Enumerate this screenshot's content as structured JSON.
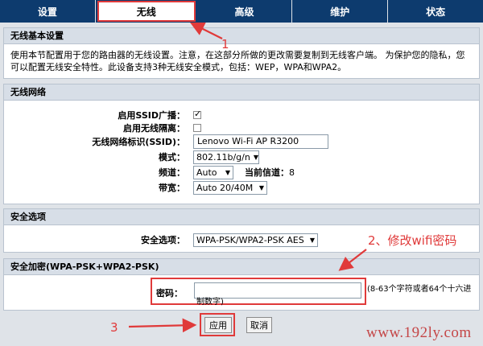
{
  "nav": {
    "tabs": [
      {
        "label": "设置"
      },
      {
        "label": "无线"
      },
      {
        "label": "高级"
      },
      {
        "label": "维护"
      },
      {
        "label": "状态"
      }
    ],
    "active_index": 1
  },
  "basic": {
    "title": "无线基本设置",
    "description": "使用本节配置用于您的路由器的无线设置。注意，在这部分所做的更改需要复制到无线客户端。 为保护您的隐私，您可以配置无线安全特性。此设备支持3种无线安全模式，包括：WEP，WPA和WPA2。"
  },
  "network": {
    "title": "无线网络",
    "ssid_broadcast_label": "启用SSID广播：",
    "ssid_broadcast_checked": true,
    "isolation_label": "启用无线隔离：",
    "isolation_checked": false,
    "ssid_label": "无线网络标识(SSID)：",
    "ssid_value": "Lenovo Wi-Fi AP R3200",
    "mode_label": "模式：",
    "mode_value": "802.11b/g/n",
    "channel_label": "频道：",
    "channel_value": "Auto",
    "current_channel_label": "当前信道：",
    "current_channel_value": "8",
    "bandwidth_label": "带宽：",
    "bandwidth_value": "Auto 20/40M"
  },
  "security": {
    "title": "安全选项",
    "option_label": "安全选项：",
    "option_value": "WPA-PSK/WPA2-PSK AES"
  },
  "encryption": {
    "title": "安全加密(WPA-PSK+WPA2-PSK)",
    "password_label": "密码：",
    "password_value": "",
    "hint": "(8-63个字符或者64个十六进制数字)"
  },
  "buttons": {
    "apply": "应用",
    "cancel": "取消"
  },
  "annotations": {
    "n1": "1",
    "n2": "2、修改wifi密码",
    "n3": "3",
    "color": "#e03a3a"
  },
  "watermark": "www.192ly.com"
}
